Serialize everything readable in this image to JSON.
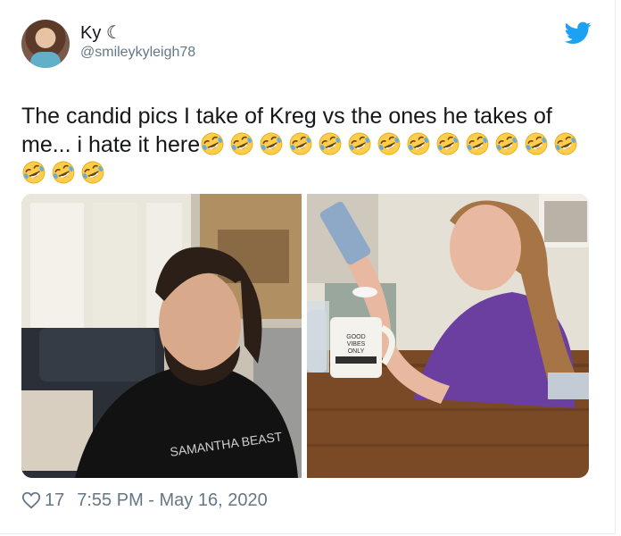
{
  "tweet": {
    "display_name": "Ky ☾",
    "handle": "@smileykyleigh78",
    "text": "The candid pics I take of Kreg vs the ones he takes of me... i hate it here",
    "emoji_count": 16,
    "emoji_name": "rolling-on-the-floor-laughing",
    "likes": "17",
    "timestamp": "7:55 PM - May 16, 2020"
  },
  "photos": {
    "right_mug_text": [
      "GOOD",
      "VIBES",
      "ONLY"
    ],
    "left_shirt_text": "SAMANTHA BEAST"
  },
  "colors": {
    "brand_blue": "#1da1f2",
    "muted_gray": "#657786",
    "text": "#14171a"
  }
}
